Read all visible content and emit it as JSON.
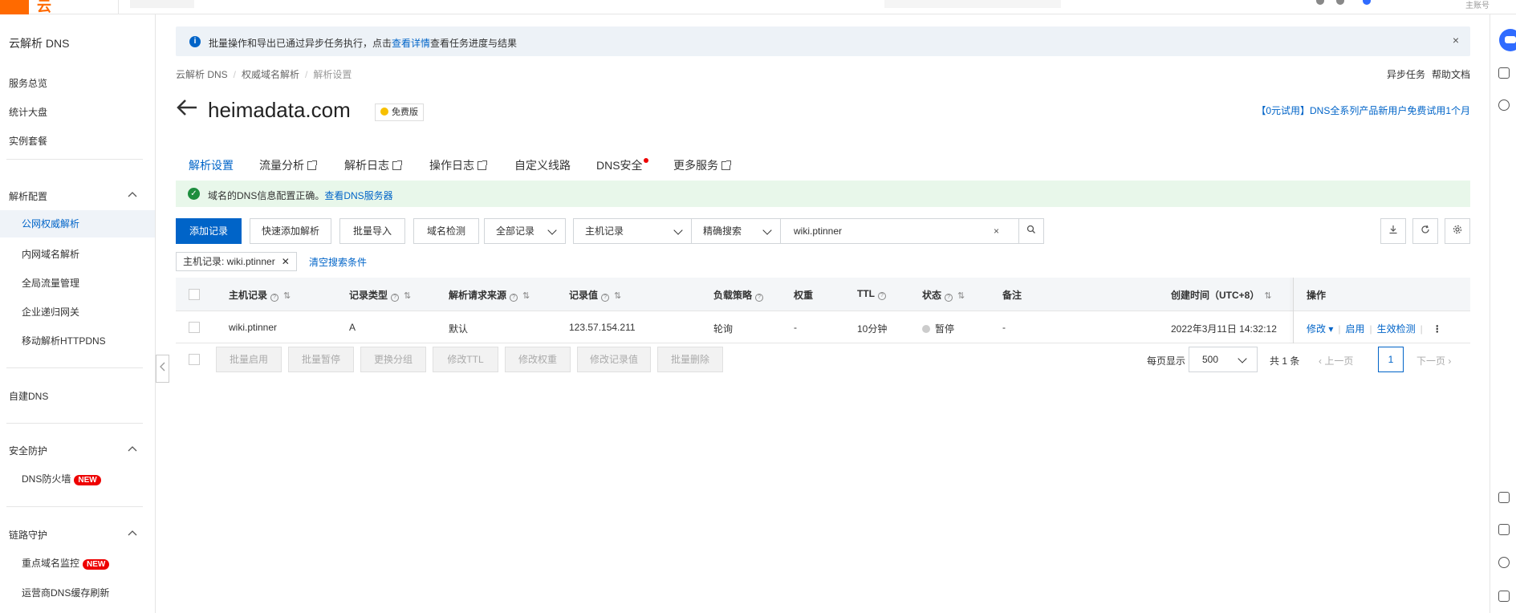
{
  "topbar": {
    "logo_text": "云",
    "account_label": "主账号"
  },
  "sidebar": {
    "title": "云解析 DNS",
    "items_top": [
      "服务总览",
      "统计大盘",
      "实例套餐"
    ],
    "group_config": "解析配置",
    "config_items": [
      "公网权威解析",
      "内网域名解析",
      "全局流量管理",
      "企业递归网关",
      "移动解析HTTPDNS"
    ],
    "self_dns": "自建DNS",
    "group_security": "安全防护",
    "security_items": [
      "DNS防火墙"
    ],
    "group_link": "链路守护",
    "link_items": [
      "重点域名监控",
      "运营商DNS缓存刷新"
    ],
    "new_badge": "NEW"
  },
  "info_banner": {
    "text": "批量操作和导出已通过异步任务执行，点击",
    "link": "查看详情",
    "text_after": "查看任务进度与结果",
    "close": "×"
  },
  "breadcrumb": [
    "云解析 DNS",
    "权威域名解析",
    "解析设置"
  ],
  "top_links": [
    "异步任务",
    "帮助文档"
  ],
  "domain": {
    "name": "heimadata.com",
    "badge": "免费版"
  },
  "promo": "【0元试用】DNS全系列产品新用户免费试用1个月",
  "tabs": [
    "解析设置",
    "流量分析",
    "解析日志",
    "操作日志",
    "自定义线路",
    "DNS安全",
    "更多服务"
  ],
  "success_banner": {
    "text": "域名的DNS信息配置正确。",
    "link": "查看DNS服务器"
  },
  "toolbar": {
    "add": "添加记录",
    "quick_add": "快速添加解析",
    "batch_import": "批量导入",
    "domain_check": "域名检测",
    "all_records": "全部记录",
    "host_record": "主机记录",
    "exact_search": "精确搜索",
    "search_value": "wiki.ptinner",
    "clear": "×"
  },
  "filter": {
    "tag": "主机记录: wiki.ptinner",
    "clear_link": "清空搜索条件"
  },
  "table": {
    "headers": [
      "主机记录",
      "记录类型",
      "解析请求来源",
      "记录值",
      "负载策略",
      "权重",
      "TTL",
      "状态",
      "备注",
      "创建时间（UTC+8）",
      "操作"
    ],
    "rows": [
      {
        "host": "wiki.ptinner",
        "type": "A",
        "source": "默认",
        "value": "123.57.154.211",
        "policy": "轮询",
        "weight": "-",
        "ttl": "10分钟",
        "status": "暂停",
        "note": "-",
        "created": "2022年3月11日 14:32:12",
        "op_modify": "修改",
        "op_enable": "启用",
        "op_check": "生效检测"
      }
    ]
  },
  "footer": {
    "bulk": [
      "批量启用",
      "批量暂停",
      "更换分组",
      "修改TTL",
      "修改权重",
      "修改记录值",
      "批量删除"
    ],
    "per_page_label": "每页显示",
    "per_page": "500",
    "total": "共 1 条",
    "prev": "上一页",
    "page": "1",
    "next": "下一页"
  }
}
